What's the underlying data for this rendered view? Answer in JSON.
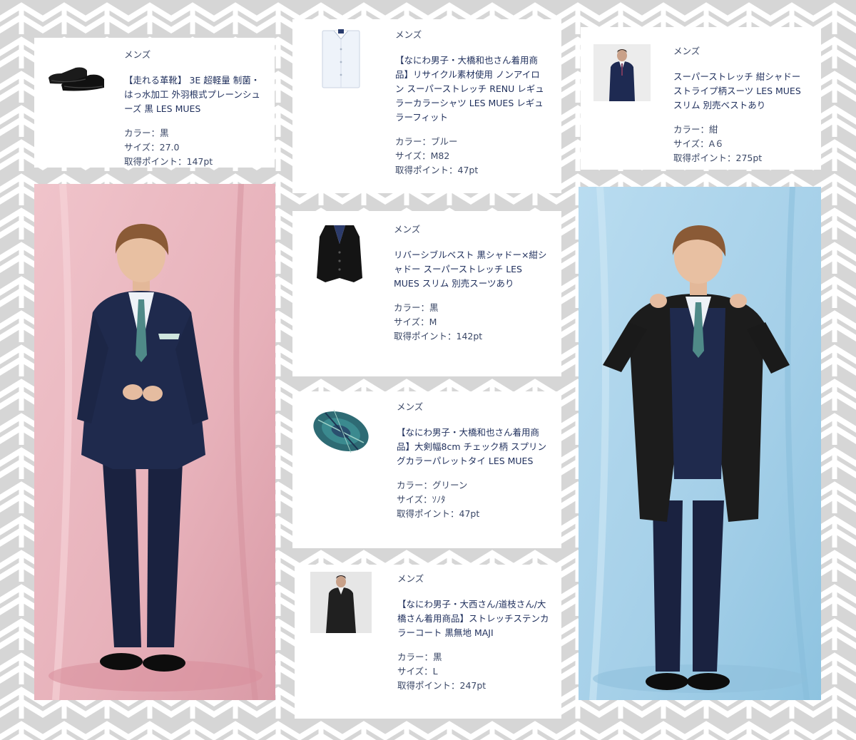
{
  "colors": {
    "background": "#d6d6d6",
    "chevron": "#ffffff",
    "card": "#ffffff",
    "text": "#1f2f5c",
    "photo_left_backdrop": "#e9b7bf",
    "photo_right_backdrop": "#a9d2ea"
  },
  "products": [
    {
      "category": "メンズ",
      "name": "【走れる革靴】 3E 超軽量 制菌・はっ水加工 外羽根式プレーンシューズ 黒 LES MUES",
      "color": "カラー：黒",
      "size": "サイズ：27.0",
      "points": "取得ポイント：147pt",
      "thumbnail_icon": "black-shoes-icon"
    },
    {
      "category": "メンズ",
      "name": "【なにわ男子・大橋和也さん着用商品】リサイクル素材使用 ノンアイロン スーパーストレッチ RENU レギュラーカラーシャツ LES MUES レギュラーフィット",
      "color": "カラー：ブルー",
      "size": "サイズ：M82",
      "points": "取得ポイント：47pt",
      "thumbnail_icon": "folded-shirt-icon"
    },
    {
      "category": "メンズ",
      "name": "スーパーストレッチ 紺シャドーストライプ柄スーツ LES MUES スリム 別売ベストあり",
      "color": "カラー：紺",
      "size": "サイズ：A６",
      "points": "取得ポイント：275pt",
      "thumbnail_icon": "suit-model-icon"
    },
    {
      "category": "メンズ",
      "name": "リバーシブルベスト 黒シャドー×紺シャドー スーパーストレッチ LES MUES スリム 別売スーツあり",
      "color": "カラー：黒",
      "size": "サイズ：M",
      "points": "取得ポイント：142pt",
      "thumbnail_icon": "vest-icon"
    },
    {
      "category": "メンズ",
      "name": "【なにわ男子・大橋和也さん着用商品】大剣幅8cm チェック柄 スプリングカラーパレットタイ LES MUES",
      "color": "カラー：グリーン",
      "size": "サイズ：ｿﾉﾀ",
      "points": "取得ポイント：47pt",
      "thumbnail_icon": "plaid-tie-icon"
    },
    {
      "category": "メンズ",
      "name": "【なにわ男子・大西さん/道枝さん/大橋さん着用商品】ストレッチステンカラーコート 黒無地 MAJI",
      "color": "カラー：黒",
      "size": "サイズ：L",
      "points": "取得ポイント：247pt",
      "thumbnail_icon": "coat-model-icon"
    }
  ]
}
